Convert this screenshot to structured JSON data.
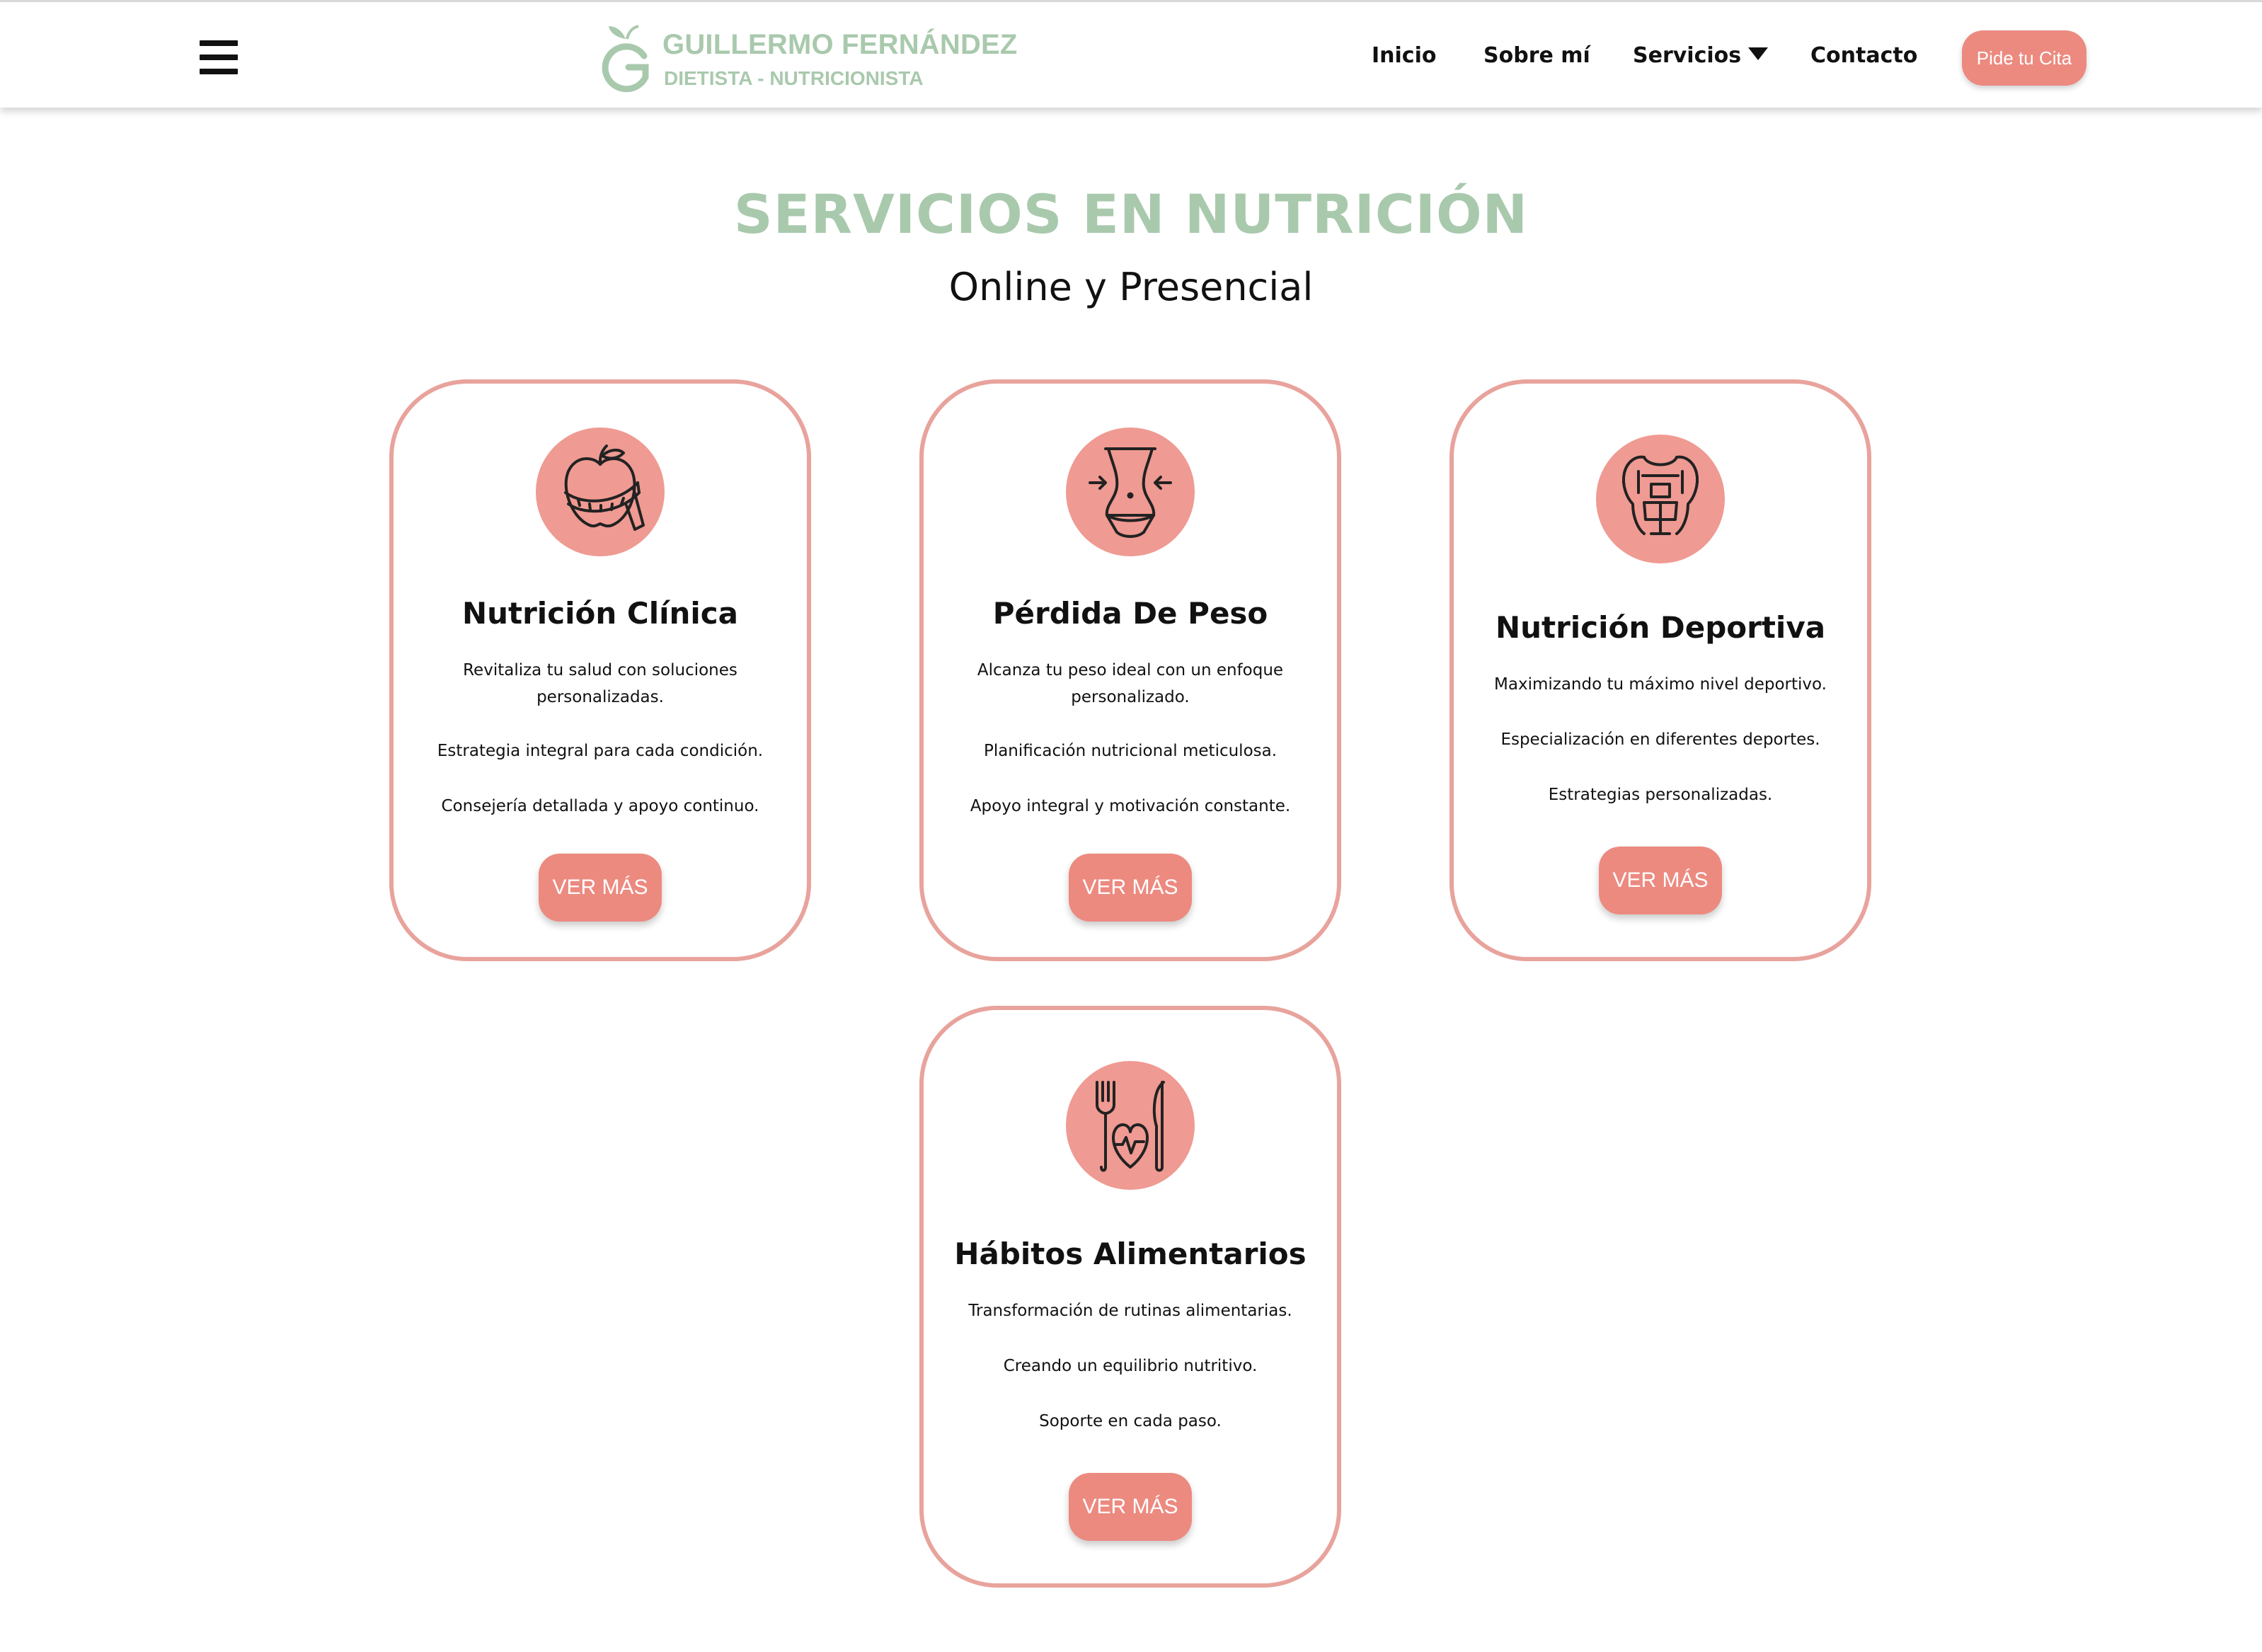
{
  "header": {
    "menu_icon": "hamburger-menu-icon",
    "logo": {
      "name": "GUILLERMO FERNÁNDEZ",
      "subtitle": "DIETISTA - NUTRICIONISTA",
      "color": "#a9c9ad"
    },
    "nav": {
      "inicio": "Inicio",
      "sobre_mi": "Sobre mí",
      "servicios": "Servicios",
      "contacto": "Contacto"
    },
    "cta_label": "Pide tu Cita"
  },
  "section": {
    "title": "SERVICIOS EN NUTRICIÓN",
    "subtitle": "Online y Presencial"
  },
  "colors": {
    "accent": "#ec8a80",
    "card_border": "#e8a39c",
    "icon_circle": "#ef9a92",
    "brand_green": "#a9c9ad"
  },
  "cards": [
    {
      "icon": "apple-tape-measure-icon",
      "title": "Nutrición Clínica",
      "lines": [
        "Revitaliza tu salud con soluciones personalizadas.",
        "Estrategia integral para cada condición.",
        "Consejería detallada y apoyo continuo."
      ],
      "button": "VER MÁS"
    },
    {
      "icon": "waist-slimming-icon",
      "title": "Pérdida De Peso",
      "lines": [
        "Alcanza tu peso ideal con un enfoque personalizado.",
        "Planificación nutricional meticulosa.",
        "Apoyo integral y motivación constante."
      ],
      "button": "VER MÁS"
    },
    {
      "icon": "muscular-torso-icon",
      "title": "Nutrición Deportiva",
      "lines": [
        "Maximizando tu máximo nivel deportivo.",
        "Especialización en diferentes deportes.",
        "Estrategias personalizadas."
      ],
      "button": "VER MÁS"
    },
    {
      "icon": "fork-knife-heart-icon",
      "title": "Hábitos Alimentarios",
      "lines": [
        "Transformación de rutinas alimentarias.",
        "Creando un equilibrio nutritivo.",
        "Soporte en cada paso."
      ],
      "button": "VER MÁS"
    }
  ]
}
